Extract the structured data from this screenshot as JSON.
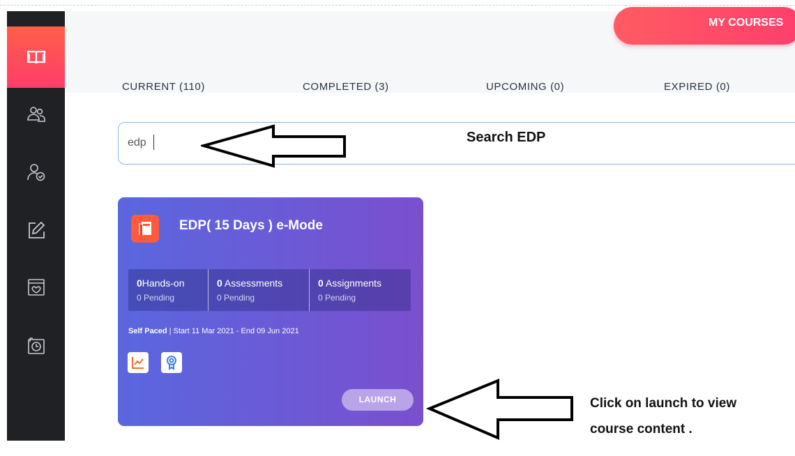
{
  "header": {
    "my_courses_label": "MY COURSES",
    "tabs": [
      {
        "label": "CURRENT (110)"
      },
      {
        "label": "COMPLETED (3)"
      },
      {
        "label": "UPCOMING (0)"
      },
      {
        "label": "EXPIRED (0)"
      }
    ]
  },
  "search": {
    "value": "edp"
  },
  "sidebar": {
    "items": [
      {
        "icon": "book-icon",
        "active": true
      },
      {
        "icon": "users-icon",
        "active": false
      },
      {
        "icon": "user-check-icon",
        "active": false
      },
      {
        "icon": "edit-icon",
        "active": false
      },
      {
        "icon": "certificate-icon",
        "active": false
      },
      {
        "icon": "history-icon",
        "active": false
      }
    ]
  },
  "annotations": {
    "search_note": "Search  EDP",
    "launch_note_line1": "Click on launch to view",
    "launch_note_line2": "course content ."
  },
  "course_card": {
    "title": "EDP( 15 Days ) e-Mode",
    "stats": [
      {
        "count": "0",
        "label": "Hands-on",
        "pending": "0 Pending"
      },
      {
        "count": "0",
        "label": " Assessments",
        "pending": "0 Pending"
      },
      {
        "count": "0",
        "label": " Assignments",
        "pending": "0 Pending"
      }
    ],
    "pace": "Self Paced",
    "dates": "Start 11 Mar 2021 - End 09 Jun 2021",
    "launch_label": "LAUNCH"
  },
  "colors": {
    "sidebar_bg": "#202124",
    "accent": "#ff4e63",
    "card_start": "#5a67df",
    "card_end": "#7a4fce"
  }
}
